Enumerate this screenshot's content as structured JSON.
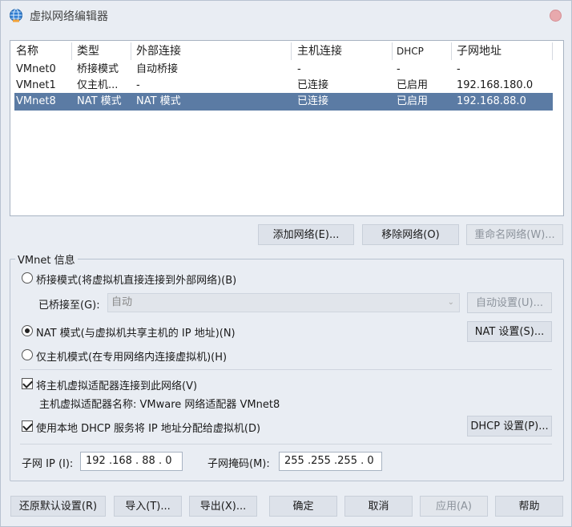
{
  "window": {
    "title": "虚拟网络编辑器"
  },
  "networks": {
    "columns": [
      "名称",
      "类型",
      "外部连接",
      "主机连接",
      "DHCP",
      "子网地址"
    ],
    "rows": [
      [
        "VMnet0",
        "桥接模式",
        "自动桥接",
        "-",
        "-",
        "-"
      ],
      [
        "VMnet1",
        "仅主机...",
        "-",
        "已连接",
        "已启用",
        "192.168.180.0"
      ],
      [
        "VMnet8",
        "NAT 模式",
        "NAT 模式",
        "已连接",
        "已启用",
        "192.168.88.0"
      ]
    ],
    "selected_index": 2
  },
  "list_buttons": {
    "add": "添加网络(E)...",
    "remove": "移除网络(O)",
    "rename": "重命名网络(W)..."
  },
  "vmnet_info": {
    "title": "VMnet 信息",
    "bridge_mode": "桥接模式(将虚拟机直接连接到外部网络)(B)",
    "bridged_to_label": "已桥接至(G):",
    "bridged_to_value": "自动",
    "auto_settings": "自动设置(U)...",
    "nat_mode": "NAT 模式(与虚拟机共享主机的 IP 地址)(N)",
    "nat_settings": "NAT 设置(S)...",
    "host_only": "仅主机模式(在专用网络内连接虚拟机)(H)",
    "connect_adapter": "将主机虚拟适配器连接到此网络(V)",
    "adapter_name": "主机虚拟适配器名称: VMware 网络适配器 VMnet8",
    "use_dhcp": "使用本地 DHCP 服务将 IP 地址分配给虚拟机(D)",
    "dhcp_settings": "DHCP 设置(P)...",
    "subnet_ip_label": "子网 IP (I):",
    "subnet_ip_value": "192 .168 . 88 . 0",
    "subnet_mask_label": "子网掩码(M):",
    "subnet_mask_value": "255 .255 .255 . 0"
  },
  "footer": {
    "restore": "还原默认设置(R)",
    "import": "导入(T)...",
    "export": "导出(X)...",
    "ok": "确定",
    "cancel": "取消",
    "apply": "应用(A)",
    "help": "帮助"
  }
}
